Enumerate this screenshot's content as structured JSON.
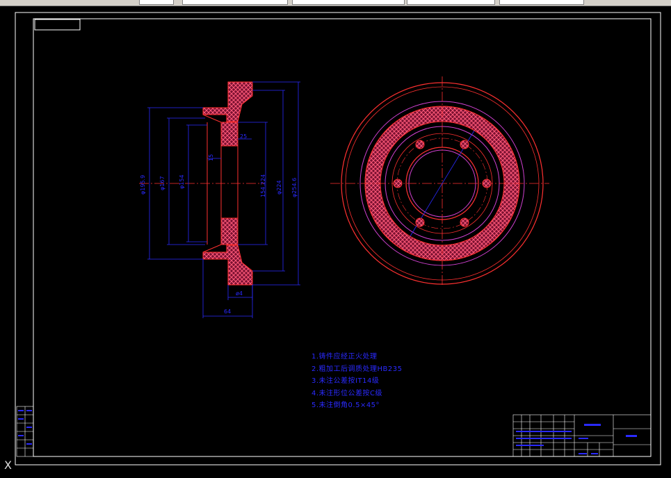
{
  "drawing": {
    "notes": [
      "1.铸件应经正火处理",
      "2.粗加工后调质处理HB235",
      "3.未注公差按IT14级",
      "4.未注形位公差按C级",
      "5.未注倒角0.5×45°"
    ],
    "dimensions": {
      "d_left_outer": "φ195.9",
      "d_left_mid": "φ167",
      "d_left_inner": "φ154",
      "d_right_154": "154.224",
      "d_right_224": "φ224",
      "d_right_outer": "φ254.6",
      "width_64": "64",
      "thick_15": "15",
      "small_8": "ø4",
      "small_24": "25"
    },
    "ucs_marker": "X"
  }
}
